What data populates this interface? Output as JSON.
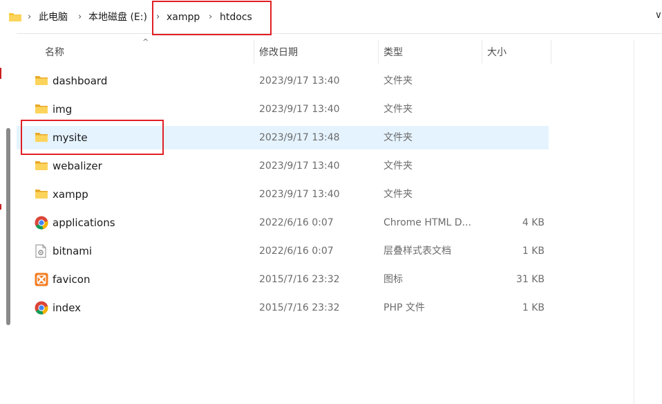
{
  "breadcrumb": [
    {
      "label": "此电脑"
    },
    {
      "label": "本地磁盘 (E:)"
    },
    {
      "label": "xampp"
    },
    {
      "label": "htdocs"
    }
  ],
  "columns": {
    "name": "名称",
    "modified": "修改日期",
    "type": "类型",
    "size": "大小"
  },
  "files": [
    {
      "name": "dashboard",
      "modified": "2023/9/17 13:40",
      "type": "文件夹",
      "size": "",
      "icon": "folder-icon"
    },
    {
      "name": "img",
      "modified": "2023/9/17 13:40",
      "type": "文件夹",
      "size": "",
      "icon": "folder-icon"
    },
    {
      "name": "mysite",
      "modified": "2023/9/17 13:48",
      "type": "文件夹",
      "size": "",
      "icon": "folder-icon",
      "selected": true
    },
    {
      "name": "webalizer",
      "modified": "2023/9/17 13:40",
      "type": "文件夹",
      "size": "",
      "icon": "folder-icon"
    },
    {
      "name": "xampp",
      "modified": "2023/9/17 13:40",
      "type": "文件夹",
      "size": "",
      "icon": "folder-icon"
    },
    {
      "name": "applications",
      "modified": "2022/6/16 0:07",
      "type": "Chrome HTML D...",
      "size": "4 KB",
      "icon": "chrome-icon"
    },
    {
      "name": "bitnami",
      "modified": "2022/6/16 0:07",
      "type": "层叠样式表文档",
      "size": "1 KB",
      "icon": "css-document-icon"
    },
    {
      "name": "favicon",
      "modified": "2015/7/16 23:32",
      "type": "图标",
      "size": "31 KB",
      "icon": "xampp-icon"
    },
    {
      "name": "index",
      "modified": "2015/7/16 23:32",
      "type": "PHP 文件",
      "size": "1 KB",
      "icon": "chrome-icon"
    }
  ],
  "colors": {
    "highlight": "#e01e23",
    "selected_row": "#e5f3ff",
    "folder": "#f8c537"
  }
}
